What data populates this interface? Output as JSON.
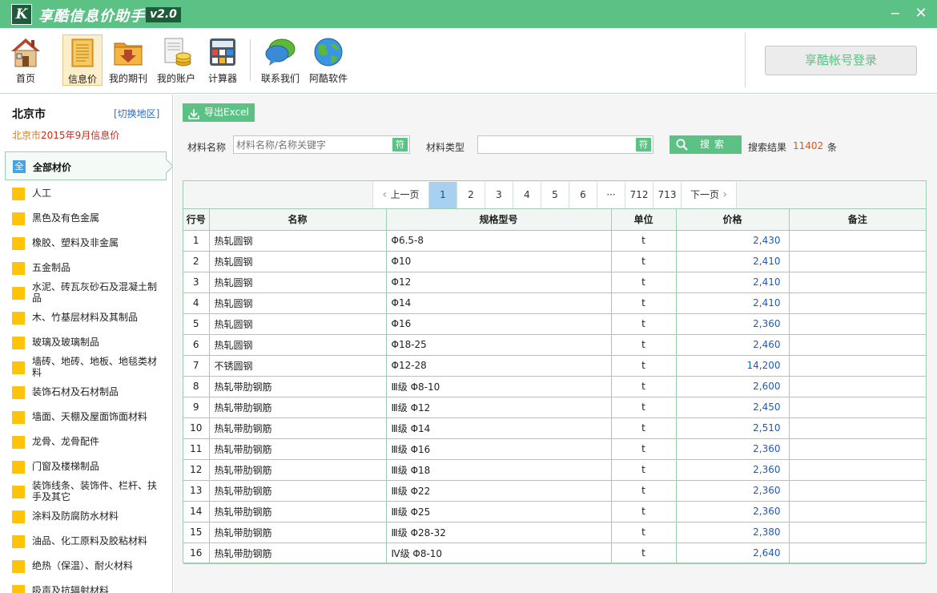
{
  "app": {
    "logo_text": "K",
    "title": "享酷信息价助手",
    "version": "v2.0",
    "minimize": "−",
    "close": "✕"
  },
  "toolbar": {
    "items": [
      {
        "label": "首页",
        "icon": "home-icon"
      },
      {
        "label": "信息价",
        "icon": "book-icon",
        "active": true
      },
      {
        "label": "我的期刊",
        "icon": "folder-download-icon"
      },
      {
        "label": "我的账户",
        "icon": "account-coins-icon"
      },
      {
        "label": "计算器",
        "icon": "calculator-icon"
      },
      {
        "label": "联系我们",
        "icon": "chat-bubbles-icon"
      },
      {
        "label": "阿酷软件",
        "icon": "globe-icon"
      }
    ],
    "login_label": "享酷帐号登录"
  },
  "sidebar": {
    "city": "北京市",
    "switch_label": "[切换地区]",
    "period_city": "北京市",
    "period_year": "2015年",
    "period_month": "9月",
    "period_suffix": "信息价",
    "all_badge": "全",
    "all_label": "全部材价",
    "categories": [
      "人工",
      "黑色及有色金属",
      "橡胶、塑料及非金属",
      "五金制品",
      "水泥、砖瓦灰砂石及混凝土制品",
      "木、竹基层材料及其制品",
      "玻璃及玻璃制品",
      "墙砖、地砖、地板、地毯类材料",
      "装饰石材及石材制品",
      "墙面、天棚及屋面饰面材料",
      "龙骨、龙骨配件",
      "门窗及楼梯制品",
      "装饰线条、装饰件、栏杆、扶手及其它",
      "涂料及防腐防水材料",
      "油品、化工原料及胶粘材料",
      "绝热（保温）、耐火材料",
      "吸声及抗辐射材料"
    ]
  },
  "filters": {
    "export_label": "导出Excel",
    "name_label": "材料名称",
    "name_placeholder": "材料名称/名称关键字",
    "name_symbol": "符",
    "type_label": "材料类型",
    "type_value": "",
    "type_symbol": "符",
    "search_label": "搜索",
    "result_label": "搜索结果",
    "result_count": "11402",
    "result_unit": "条"
  },
  "pager": {
    "prev": "上一页",
    "next": "下一页",
    "pages": [
      "1",
      "2",
      "3",
      "4",
      "5",
      "6",
      "···",
      "712",
      "713"
    ],
    "current": "1"
  },
  "table": {
    "headers": [
      "行号",
      "名称",
      "规格型号",
      "单位",
      "价格",
      "备注"
    ],
    "rows": [
      [
        "1",
        "热轧圆钢",
        "Φ6.5-8",
        "t",
        "2,430",
        ""
      ],
      [
        "2",
        "热轧圆钢",
        "Φ10",
        "t",
        "2,410",
        ""
      ],
      [
        "3",
        "热轧圆钢",
        "Φ12",
        "t",
        "2,410",
        ""
      ],
      [
        "4",
        "热轧圆钢",
        "Φ14",
        "t",
        "2,410",
        ""
      ],
      [
        "5",
        "热轧圆钢",
        "Φ16",
        "t",
        "2,360",
        ""
      ],
      [
        "6",
        "热轧圆钢",
        "Φ18-25",
        "t",
        "2,460",
        ""
      ],
      [
        "7",
        "不锈圆钢",
        "Φ12-28",
        "t",
        "14,200",
        ""
      ],
      [
        "8",
        "热轧带肋钢筋",
        "Ⅲ级 Φ8-10",
        "t",
        "2,600",
        ""
      ],
      [
        "9",
        "热轧带肋钢筋",
        "Ⅲ级 Φ12",
        "t",
        "2,450",
        ""
      ],
      [
        "10",
        "热轧带肋钢筋",
        "Ⅲ级 Φ14",
        "t",
        "2,510",
        ""
      ],
      [
        "11",
        "热轧带肋钢筋",
        "Ⅲ级 Φ16",
        "t",
        "2,360",
        ""
      ],
      [
        "12",
        "热轧带肋钢筋",
        "Ⅲ级 Φ18",
        "t",
        "2,360",
        ""
      ],
      [
        "13",
        "热轧带肋钢筋",
        "Ⅲ级 Φ22",
        "t",
        "2,360",
        ""
      ],
      [
        "14",
        "热轧带肋钢筋",
        "Ⅲ级 Φ25",
        "t",
        "2,360",
        ""
      ],
      [
        "15",
        "热轧带肋钢筋",
        "Ⅲ级 Φ28-32",
        "t",
        "2,380",
        ""
      ],
      [
        "16",
        "热轧带肋钢筋",
        "Ⅳ级 Φ8-10",
        "t",
        "2,640",
        ""
      ]
    ]
  },
  "colors": {
    "accent": "#5cc185",
    "dark_green": "#1e5b3a",
    "price_blue": "#1c5bbd",
    "count_orange": "#e2561a",
    "category_yellow": "#ffc409"
  }
}
